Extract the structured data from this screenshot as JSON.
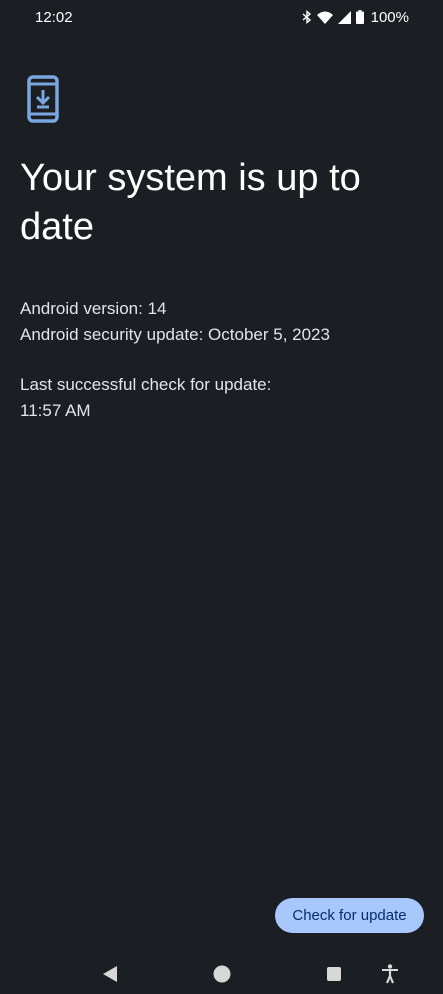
{
  "status_bar": {
    "time": "12:02",
    "battery_percent": "100%",
    "icons": [
      "bluetooth-icon",
      "wifi-icon",
      "cell-signal-icon",
      "battery-icon"
    ]
  },
  "header": {
    "icon": "system-update-icon",
    "title": "Your system is up to date"
  },
  "info": {
    "android_version": "Android version: 14",
    "security_update": "Android security update: October 5, 2023",
    "last_check_label": "Last successful check for update:",
    "last_check_time": "11:57 AM"
  },
  "actions": {
    "check_label": "Check for update"
  },
  "nav_bar": {
    "icons": [
      "back-icon",
      "home-icon",
      "recents-icon",
      "accessibility-icon"
    ]
  },
  "colors": {
    "background": "#1b1e23",
    "accent": "#a8c7fa",
    "on_accent": "#062e6f",
    "icon_blue": "#7aa7e0"
  }
}
